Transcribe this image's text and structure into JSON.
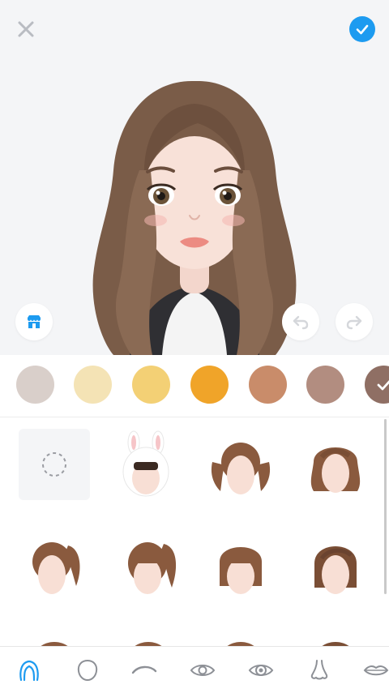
{
  "toolbar": {
    "close_icon": "close-icon",
    "confirm_icon": "checkmark-icon",
    "confirm_color": "#1d9bf0"
  },
  "preview": {
    "background": "#f4f5f7",
    "store_icon": "store-icon",
    "undo_icon": "undo-icon",
    "redo_icon": "redo-icon"
  },
  "hair_colors": [
    {
      "name": "light-gray",
      "hex": "#d9cfca",
      "selected": false
    },
    {
      "name": "cream",
      "hex": "#f4e3b5",
      "selected": false
    },
    {
      "name": "yellow",
      "hex": "#f3d075",
      "selected": false
    },
    {
      "name": "orange",
      "hex": "#f0a429",
      "selected": false
    },
    {
      "name": "tan",
      "hex": "#c98c6a",
      "selected": false
    },
    {
      "name": "brown-gray",
      "hex": "#b28d80",
      "selected": false
    },
    {
      "name": "dark-brown",
      "hex": "#8f6f64",
      "selected": true
    }
  ],
  "hair_styles": [
    {
      "name": "none"
    },
    {
      "name": "bunny-hood"
    },
    {
      "name": "twin-tails"
    },
    {
      "name": "wavy-bob"
    },
    {
      "name": "side-ponytail"
    },
    {
      "name": "bangs-ponytail"
    },
    {
      "name": "bangs-bob"
    },
    {
      "name": "sleek-bob"
    }
  ],
  "tabs": [
    {
      "name": "hair",
      "active": true
    },
    {
      "name": "face-shape",
      "active": false
    },
    {
      "name": "eyebrows",
      "active": false
    },
    {
      "name": "eyes",
      "active": false
    },
    {
      "name": "eye-color",
      "active": false
    },
    {
      "name": "nose",
      "active": false
    },
    {
      "name": "lips",
      "active": false
    }
  ]
}
